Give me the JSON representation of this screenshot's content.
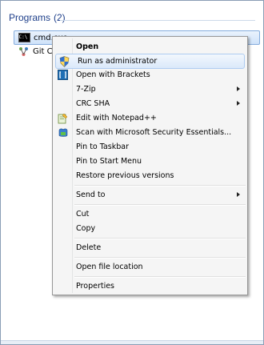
{
  "group": {
    "title": "Programs",
    "count": "(2)"
  },
  "programs": [
    {
      "label": "cmd.exe",
      "icon": "cmd-icon"
    },
    {
      "label": "Git CM",
      "icon": "git-icon"
    }
  ],
  "menu": {
    "items": [
      {
        "label": "Open",
        "bold": true
      },
      {
        "label": "Run as administrator",
        "icon": "uac-shield-icon"
      },
      {
        "label": "Open with Brackets",
        "icon": "brackets-icon"
      },
      {
        "label": "7-Zip",
        "submenu": true
      },
      {
        "label": "CRC SHA",
        "submenu": true
      },
      {
        "label": "Edit with Notepad++",
        "icon": "notepadpp-icon"
      },
      {
        "label": "Scan with Microsoft Security Essentials...",
        "icon": "mse-icon"
      },
      {
        "label": "Pin to Taskbar"
      },
      {
        "label": "Pin to Start Menu"
      },
      {
        "label": "Restore previous versions"
      },
      {
        "label": "Send to",
        "submenu": true
      },
      {
        "label": "Cut"
      },
      {
        "label": "Copy"
      },
      {
        "label": "Delete"
      },
      {
        "label": "Open file location"
      },
      {
        "label": "Properties"
      }
    ]
  },
  "colors": {
    "header_text": "#1e3f8a",
    "selection_border": "#84acdd",
    "menu_bg": "#f5f5f5"
  }
}
